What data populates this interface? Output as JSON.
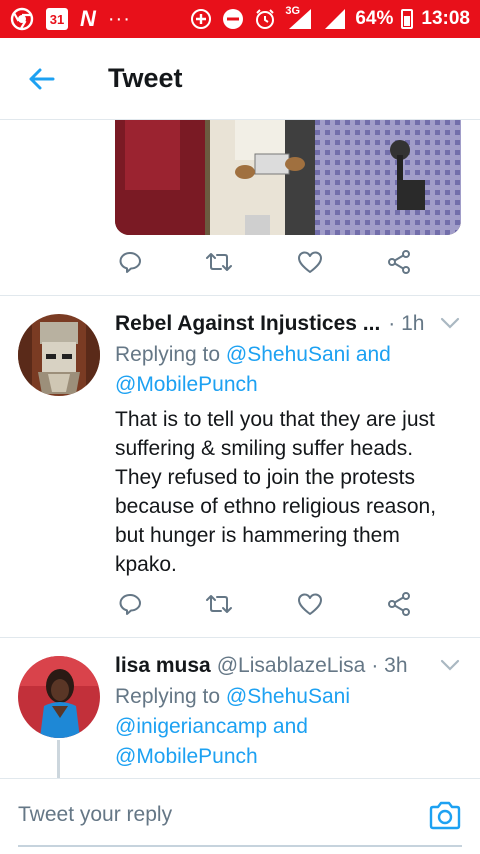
{
  "statusbar": {
    "battery": "64%",
    "time": "13:08",
    "calendar_day": "31",
    "network": "3G",
    "app_letter": "N",
    "dots": "···"
  },
  "header": {
    "title": "Tweet"
  },
  "tweets": [
    {
      "name": "Rebel Against Injustices ...",
      "time": "· 1h",
      "replying_prefix": "Replying to",
      "replying_to_1": "@ShehuSani and",
      "replying_to_2": "@MobilePunch",
      "body": "That is to tell you that they are just suffering & smiling suffer heads. They refused to join the protests because of ethno religious reason, but hunger is hammering them kpako."
    },
    {
      "name": "lisa musa",
      "handle": "@LisablazeLisa",
      "time": "· 3h",
      "replying_prefix": "Replying to",
      "replying_to_1": "@ShehuSani",
      "replying_to_2": "@inigeriancamp and",
      "replying_to_3": "@MobilePunch"
    }
  ],
  "reply_bar": {
    "placeholder": "Tweet your reply"
  },
  "colors": {
    "status_bar": "#e8101a",
    "accent": "#1da1f2",
    "muted": "#657786"
  }
}
